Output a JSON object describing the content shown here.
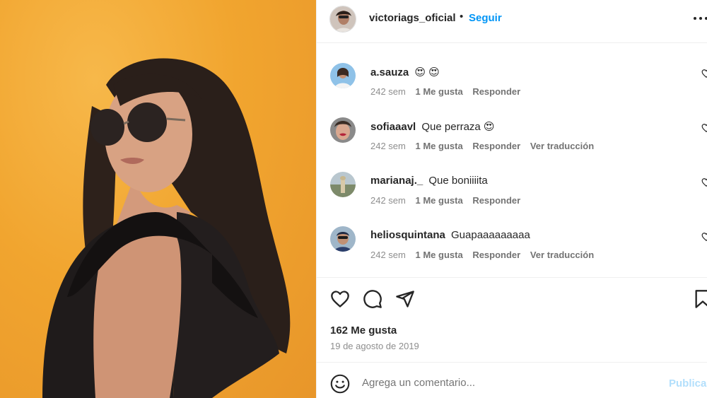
{
  "post": {
    "username": "victoriags_oficial",
    "separator": "•",
    "follow_label": "Seguir",
    "more_icon": "more-horizontal-icon"
  },
  "comments": [
    {
      "user": "a.sauza",
      "text": "😍 😍",
      "time": "242 sem",
      "likes": "1 Me gusta",
      "reply": "Responder",
      "translate": ""
    },
    {
      "user": "sofiaaavl",
      "text": "Que perraza 😍",
      "time": "242 sem",
      "likes": "1 Me gusta",
      "reply": "Responder",
      "translate": "Ver traducción"
    },
    {
      "user": "marianaj._",
      "text": "Que boniiiita",
      "time": "242 sem",
      "likes": "1 Me gusta",
      "reply": "Responder",
      "translate": ""
    },
    {
      "user": "heliosquintana",
      "text": "Guapaaaaaaaaa",
      "time": "242 sem",
      "likes": "1 Me gusta",
      "reply": "Responder",
      "translate": "Ver traducción"
    }
  ],
  "actions": {
    "likes_count": "162 Me gusta",
    "date": "19 de agosto de 2019"
  },
  "add_comment": {
    "placeholder": "Agrega un comentario...",
    "publish_label": "Publicar"
  },
  "colors": {
    "link": "#0095f6",
    "publish_disabled": "#b2dffc",
    "photo_background": "#f1a52f"
  }
}
